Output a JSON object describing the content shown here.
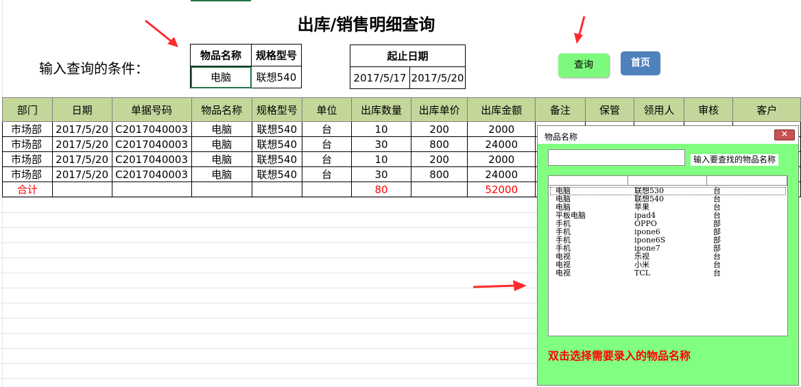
{
  "page": {
    "title": "出库/销售明细查询",
    "condition_label": "输入查询的条件："
  },
  "query": {
    "name_header": "物品名称",
    "spec_header": "规格型号",
    "date_header": "起止日期",
    "name_value": "电脑",
    "spec_value": "联想540",
    "date_start": "2017/5/17",
    "date_end": "2017/5/20"
  },
  "buttons": {
    "query": "查询",
    "home": "首页"
  },
  "table": {
    "headers": [
      "部门",
      "日期",
      "单据号码",
      "物品名称",
      "规格型号",
      "单位",
      "出库数量",
      "出库单价",
      "出库金额",
      "备注",
      "保管",
      "领用人",
      "审核",
      "客户"
    ],
    "rows": [
      [
        "市场部",
        "2017/5/20",
        "C2017040003",
        "电脑",
        "联想540",
        "台",
        "10",
        "200",
        "2000"
      ],
      [
        "市场部",
        "2017/5/20",
        "C2017040003",
        "电脑",
        "联想540",
        "台",
        "30",
        "800",
        "24000"
      ],
      [
        "市场部",
        "2017/5/20",
        "C2017040003",
        "电脑",
        "联想540",
        "台",
        "10",
        "200",
        "2000"
      ],
      [
        "市场部",
        "2017/5/20",
        "C2017040003",
        "电脑",
        "联想540",
        "台",
        "30",
        "800",
        "24000"
      ]
    ],
    "total": {
      "label": "合计",
      "qty": "80",
      "amount": "52000"
    }
  },
  "dialog": {
    "title": "物品名称",
    "close_label": "✕",
    "search_value": "",
    "hint": "输入要查找的物品名称",
    "items": [
      [
        "电脑",
        "联想530",
        "台"
      ],
      [
        "电脑",
        "联想540",
        "台"
      ],
      [
        "电脑",
        "苹果",
        "台"
      ],
      [
        "平板电脑",
        "ipad4",
        "台"
      ],
      [
        "手机",
        "OPPO",
        "部"
      ],
      [
        "手机",
        "ipone6",
        "部"
      ],
      [
        "手机",
        "ipone6S",
        "部"
      ],
      [
        "手机",
        "ipone7",
        "部"
      ],
      [
        "电视",
        "乐视",
        "台"
      ],
      [
        "电视",
        "小米",
        "台"
      ],
      [
        "电视",
        "TCL",
        "台"
      ]
    ],
    "footer": "双击选择需要录入的物品名称"
  },
  "colors": {
    "header_bg": "#c4d79b",
    "dialog_bg": "#80ff80",
    "query_button": "#7dfa7d",
    "home_button": "#4f81bd",
    "accent_red": "#ff0000"
  }
}
